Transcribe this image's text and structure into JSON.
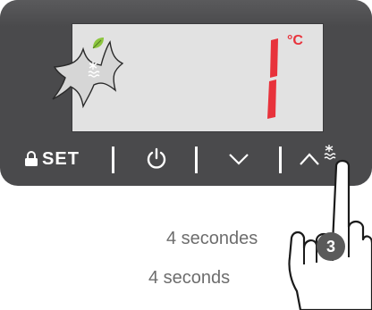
{
  "display": {
    "digit": "1",
    "unit": "°C",
    "digit_color": "#e8323b",
    "highlight_icon": "leaf-icon",
    "status_icon": "defrost-icon"
  },
  "buttons": {
    "set_label": "SET",
    "lock_icon": "lock-icon",
    "power_icon": "power-icon",
    "down_icon": "chevron-down-icon",
    "up_icon": "chevron-up-icon",
    "up_secondary_icon": "defrost-icon"
  },
  "instruction": {
    "duration_fr": "4 secondes",
    "duration_en": "4 seconds",
    "step_number": "3"
  },
  "colors": {
    "panel": "#4a4a4c",
    "lcd": "#e2e2e2",
    "accent_green": "#8dc63f",
    "text_gray": "#6d6d6d"
  }
}
